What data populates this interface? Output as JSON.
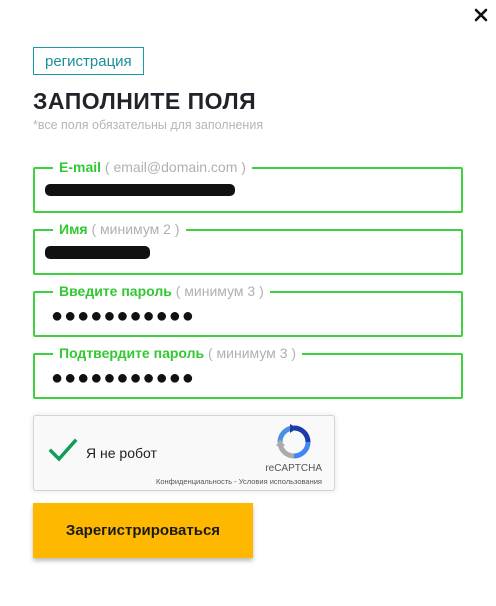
{
  "tab": {
    "label": "регистрация"
  },
  "heading": "ЗАПОЛНИТЕ ПОЛЯ",
  "note": "*все поля обязательны для заполнения",
  "fields": [
    {
      "label": "E-mail",
      "hint": " ( email@domain.com )",
      "value_masked": true
    },
    {
      "label": "Имя",
      "hint": " ( минимум 2 )",
      "value_masked": true
    },
    {
      "label": "Введите пароль",
      "hint": " ( минимум 3 )",
      "value": "●●●●●●●●●●●"
    },
    {
      "label": "Подтвердите пароль",
      "hint": " ( минимум 3 )",
      "value": "●●●●●●●●●●●"
    }
  ],
  "captcha": {
    "label": "Я не робот",
    "checked": true,
    "brand": "reCAPTCHA",
    "privacy": "Конфиденциальность",
    "separator": " - ",
    "terms": "Условия использования"
  },
  "submit_label": "Зарегистрироваться",
  "icons": {
    "close": "close-icon",
    "check": "checkmark-icon",
    "recaptcha": "recaptcha-logo-icon"
  },
  "colors": {
    "accent_green": "#3fd13f",
    "tab_teal": "#1a9aa3",
    "button_yellow": "#ffb800"
  }
}
